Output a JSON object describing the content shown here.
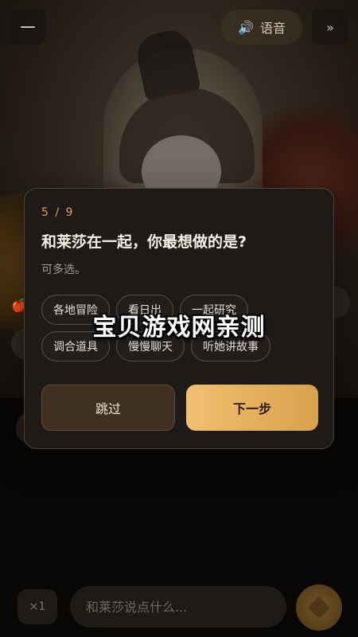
{
  "header": {
    "menu_icon": "menu-icon",
    "voice_label": "语音",
    "voice_icon": "speaker-icon",
    "fast_forward_icon": "fast-forward-icon"
  },
  "dialog": {
    "step": "5 / 9",
    "question": "和莱莎在一起，你最想做的是?",
    "hint": "可多选。",
    "options": [
      "各地冒险",
      "看日出",
      "一起研究",
      "调合道具",
      "慢慢聊天",
      "听她讲故事"
    ],
    "skip_label": "跳过",
    "next_label": "下一步"
  },
  "footer": {
    "multiplier_label": "×1",
    "input_placeholder": "和莱莎说点什么...",
    "send_icon": "heart-icon"
  },
  "watermark": "宝贝游戏网亲测",
  "colors": {
    "accent": "#d8a54e",
    "next_button_start": "#f0c071",
    "next_button_end": "#d8a14c",
    "dialog_bg": "#1e1a18"
  }
}
